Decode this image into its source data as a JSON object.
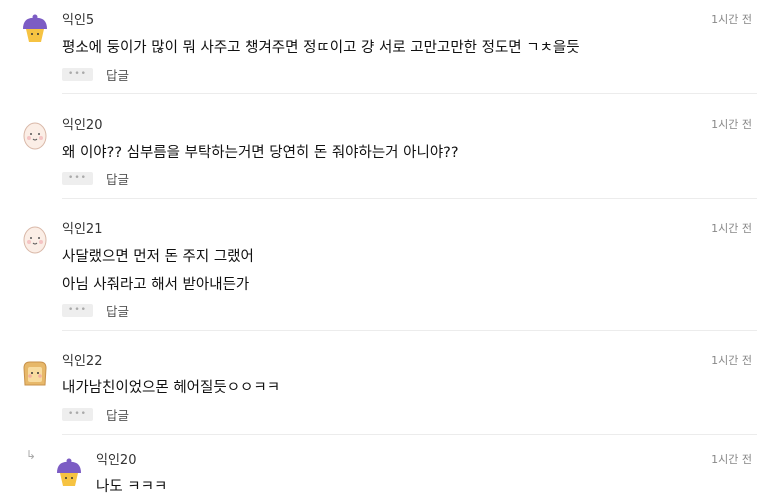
{
  "comments": [
    {
      "author": "익인5",
      "time": "1시간 전",
      "lines": [
        "평소에 둥이가 많이 뭐 사주고 챙겨주면 정ㄸ이고 걍 서로 고만고만한 정도면 ㄱㅊ을듯"
      ],
      "more": "•••",
      "reply": "답글",
      "avatar": "cupcake-icon"
    },
    {
      "author": "익인20",
      "time": "1시간 전",
      "lines": [
        "왜 이야?? 심부름을 부탁하는거면 당연히 돈 줘야하는거 아니야??"
      ],
      "more": "•••",
      "reply": "답글",
      "avatar": "egg-icon"
    },
    {
      "author": "익인21",
      "time": "1시간 전",
      "lines": [
        "사달랬으면 먼저 돈 주지 그랬어",
        "아님 사줘라고 해서 받아내든가"
      ],
      "more": "•••",
      "reply": "답글",
      "avatar": "egg-icon"
    },
    {
      "author": "익인22",
      "time": "1시간 전",
      "lines": [
        "내가남친이었으몬 헤어질듯ㅇㅇㅋㅋ"
      ],
      "more": "•••",
      "reply": "답글",
      "avatar": "toast-icon"
    }
  ],
  "nested": {
    "author": "익인20",
    "time": "1시간 전",
    "lines": [
      "나도 ㅋㅋㅋ"
    ],
    "avatar": "cupcake-icon",
    "arrow": "↳"
  }
}
